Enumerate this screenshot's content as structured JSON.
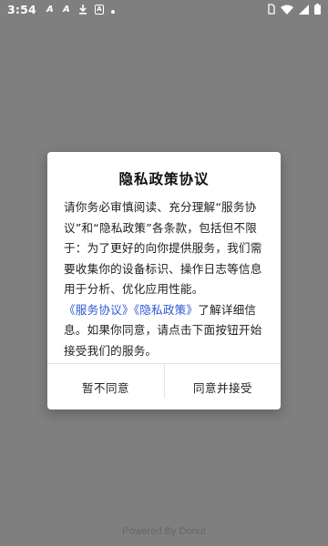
{
  "status_bar": {
    "time": "3:54",
    "notification_icons": [
      "a-icon",
      "a-icon",
      "download-icon",
      "a-box-icon",
      "dot-icon"
    ],
    "right_icons": [
      "sim-card-icon",
      "wifi-icon",
      "signal-icon",
      "battery-icon"
    ]
  },
  "dialog": {
    "title": "隐私政策协议",
    "body_text": "请你务必审慎阅读、充分理解“服务协议”和“隐私政策”各条款，包括但不限于：为了更好的向你提供服务，我们需要收集你的设备标识、操作日志等信息用于分析、优化应用性能。",
    "link_service": "《服务协议》",
    "link_privacy": "《隐私政策》",
    "body_text_end": "了解详细信息。如果你同意，请点击下面按钮开始接受我们的服务。",
    "decline_label": "暂不同意",
    "agree_label": "同意并接受"
  },
  "footer": {
    "text": "Powered By Donut"
  },
  "colors": {
    "overlay": "#7f7f7f",
    "link": "#2c58d6",
    "dialog_bg": "#ffffff"
  }
}
